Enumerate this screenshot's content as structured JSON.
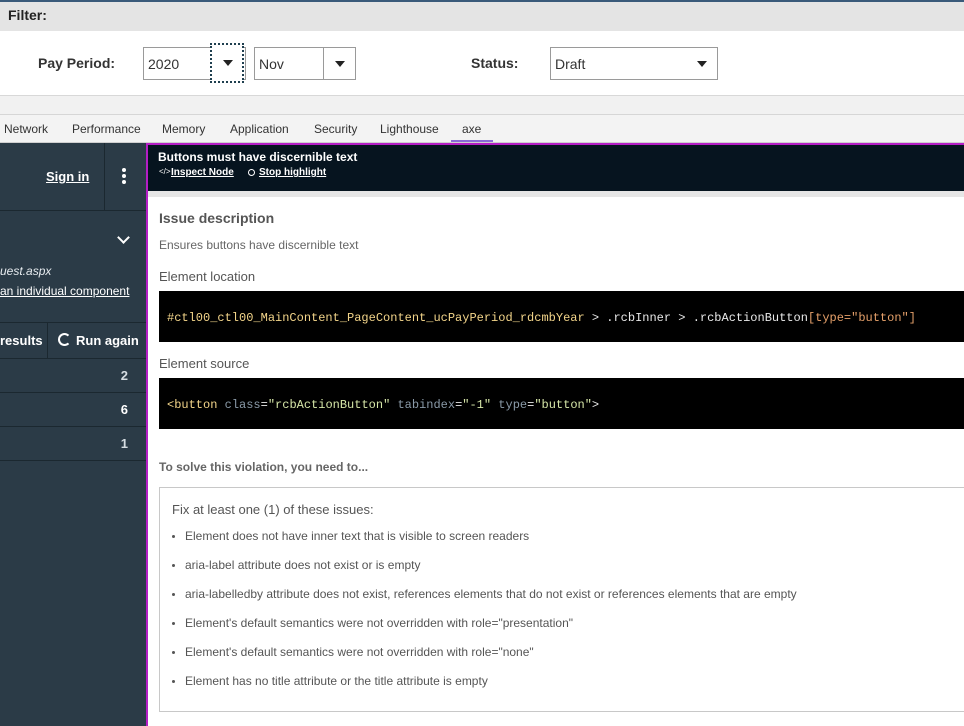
{
  "filter": {
    "title": "Filter:",
    "pay_period_label": "Pay Period:",
    "year_value": "2020",
    "month_value": "Nov",
    "status_label": "Status:",
    "status_value": "Draft"
  },
  "devtools_tabs": [
    "Network",
    "Performance",
    "Memory",
    "Application",
    "Security",
    "Lighthouse",
    "axe"
  ],
  "active_tab": "axe",
  "left_panel": {
    "sign_in": "Sign in",
    "page_path": "uest.aspx",
    "component_link": "an individual component",
    "results_label": "results",
    "run_again": "Run again",
    "counts": [
      "2",
      "6",
      "1"
    ]
  },
  "issue": {
    "title": "Buttons must have discernible text",
    "inspect_node": "Inspect Node",
    "stop_highlight": "Stop highlight",
    "desc_heading": "Issue description",
    "desc_text": "Ensures buttons have discernible text",
    "location_heading": "Element location",
    "location_selector": "#ctl00_ctl00_MainContent_PageContent_ucPayPeriod_rdcmbYear",
    "location_rest_1": " > .rcbInner > .rcbActionButton",
    "location_attr": "[type=\"button\"]",
    "source_heading": "Element source",
    "src_open": "<button",
    "src_attr1_name": "class",
    "src_attr1_val": "\"rcbActionButton\"",
    "src_attr2_name": "tabindex",
    "src_attr2_val": "\"-1\"",
    "src_attr3_name": "type",
    "src_attr3_val": "\"button\"",
    "src_close": ">",
    "solve_heading": "To solve this violation, you need to...",
    "fix_heading": "Fix at least one (1) of these issues:",
    "fixes": [
      "Element does not have inner text that is visible to screen readers",
      "aria-label attribute does not exist or is empty",
      "aria-labelledby attribute does not exist, references elements that do not exist or references elements that are empty",
      "Element's default semantics were not overridden with role=\"presentation\"",
      "Element's default semantics were not overridden with role=\"none\"",
      "Element has no title attribute or the title attribute is empty"
    ]
  },
  "colors": {
    "accent": "#b51ec6",
    "header_bg": "#06141f",
    "left_panel_bg": "#2b3b47",
    "selector_color": "#f3d58a",
    "attr_color": "#e5a06a"
  }
}
